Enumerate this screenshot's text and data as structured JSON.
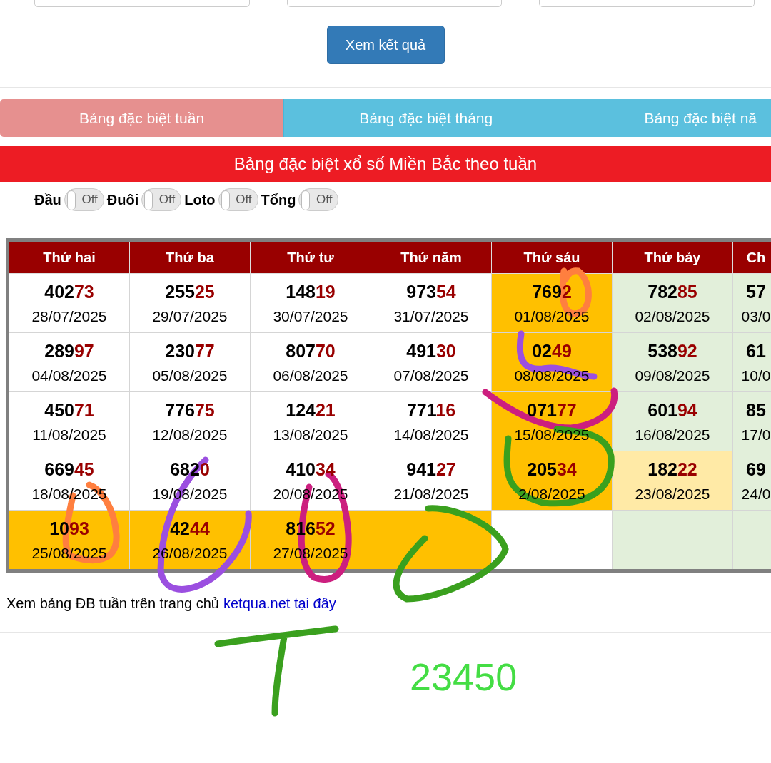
{
  "submit_button": "Xem kết quả",
  "tabs": [
    {
      "label": "Bảng đặc biệt tuần",
      "selected": true
    },
    {
      "label": "Bảng đặc biệt tháng",
      "selected": false
    },
    {
      "label": "Bảng đặc biệt nă",
      "selected": false
    }
  ],
  "banner": "Bảng đặc biệt xổ số Miền Bắc theo tuần",
  "toggles": [
    {
      "label": "Đầu",
      "state": "Off",
      "on": false
    },
    {
      "label": "Đuôi",
      "state": "Off",
      "on": false
    },
    {
      "label": "Loto",
      "state": "Off",
      "on": false
    },
    {
      "label": "Tổng",
      "state": "Off",
      "on": false
    }
  ],
  "table": {
    "columns": [
      "Thứ hai",
      "Thứ ba",
      "Thứ tư",
      "Thứ năm",
      "Thứ sáu",
      "Thứ bảy",
      "Ch"
    ],
    "rows": [
      [
        {
          "head": "402",
          "tail": "73",
          "date": "28/07/2025",
          "color": "#ffffff"
        },
        {
          "head": "255",
          "tail": "25",
          "date": "29/07/2025",
          "color": "#ffffff"
        },
        {
          "head": "148",
          "tail": "19",
          "date": "30/07/2025",
          "color": "#ffffff"
        },
        {
          "head": "973",
          "tail": "54",
          "date": "31/07/2025",
          "color": "#ffffff"
        },
        {
          "head": "769",
          "tail": "2",
          "date": "01/08/2025",
          "color": "#ffc000"
        },
        {
          "head": "782",
          "tail": "85",
          "date": "02/08/2025",
          "color": "#e2efda"
        },
        {
          "head": "57",
          "date": "03/0",
          "color": "#e2efda"
        }
      ],
      [
        {
          "head": "289",
          "tail": "97",
          "date": "04/08/2025",
          "color": "#ffffff"
        },
        {
          "head": "230",
          "tail": "77",
          "date": "05/08/2025",
          "color": "#ffffff"
        },
        {
          "head": "807",
          "tail": "70",
          "date": "06/08/2025",
          "color": "#ffffff"
        },
        {
          "head": "491",
          "tail": "30",
          "date": "07/08/2025",
          "color": "#ffffff"
        },
        {
          "head": "02",
          "tail": "49",
          "date": "08/08/2025",
          "color": "#ffc000"
        },
        {
          "head": "538",
          "tail": "92",
          "date": "09/08/2025",
          "color": "#e2efda"
        },
        {
          "head": "61",
          "date": "10/0",
          "color": "#e2efda"
        }
      ],
      [
        {
          "head": "450",
          "tail": "71",
          "date": "11/08/2025",
          "color": "#ffffff"
        },
        {
          "head": "776",
          "tail": "75",
          "date": "12/08/2025",
          "color": "#ffffff"
        },
        {
          "head": "124",
          "tail": "21",
          "date": "13/08/2025",
          "color": "#ffffff"
        },
        {
          "head": "771",
          "tail": "16",
          "date": "14/08/2025",
          "color": "#ffffff"
        },
        {
          "head": "071",
          "tail": "77",
          "date": "15/08/2025",
          "color": "#ffc000"
        },
        {
          "head": "601",
          "tail": "94",
          "date": "16/08/2025",
          "color": "#e2efda"
        },
        {
          "head": "85",
          "date": "17/0",
          "color": "#e2efda"
        }
      ],
      [
        {
          "head": "669",
          "tail": "45",
          "date": "18/08/2025",
          "color": "#ffffff"
        },
        {
          "head": "682",
          "tail": "0",
          "date": "19/08/2025",
          "color": "#ffffff"
        },
        {
          "head": "410",
          "tail": "34",
          "date": "20/08/2025",
          "color": "#ffffff"
        },
        {
          "head": "941",
          "tail": "27",
          "date": "21/08/2025",
          "color": "#ffffff"
        },
        {
          "head": "205",
          "tail": "34",
          "date": "2/08/2025",
          "color": "#ffc000"
        },
        {
          "head": "182",
          "tail": "22",
          "date": "23/08/2025",
          "color": "#ffeaa6"
        },
        {
          "head": "69",
          "date": "24/0",
          "color": "#e2efda"
        }
      ],
      [
        {
          "head": "10",
          "tail": "93",
          "date": "25/08/2025",
          "color": "#ffc000"
        },
        {
          "head": "42",
          "tail": "44",
          "date": "26/08/2025",
          "color": "#ffc000"
        },
        {
          "head": "816",
          "tail": "52",
          "date": "27/08/2025",
          "color": "#ffc000"
        },
        {
          "color": "#ffc000"
        },
        {
          "color": "#ffffff"
        },
        {
          "color": "#e2efda"
        },
        {
          "color": "#e2efda"
        }
      ]
    ]
  },
  "footer_note": {
    "text": "Xem bảng ĐB tuần trên trang chủ",
    "link": "ketqua.net tại đây"
  },
  "handwritten_number": "23450"
}
